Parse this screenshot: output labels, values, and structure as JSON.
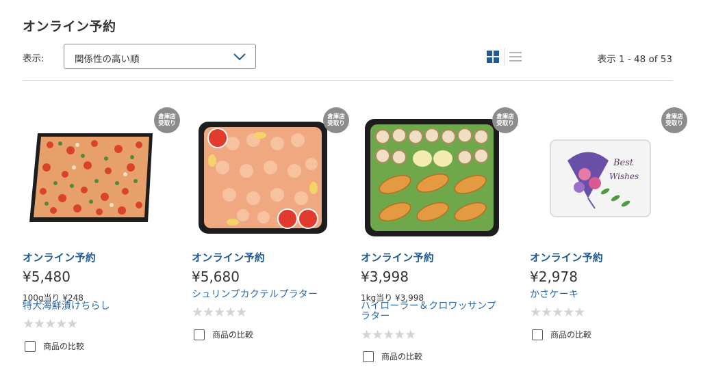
{
  "page": {
    "title": "オンライン予約"
  },
  "toolbar": {
    "sort_label": "表示:",
    "sort_value": "関係性の高い順",
    "result_count": "表示 1 - 48 of 53",
    "grid_icon": "grid-view-icon",
    "list_icon": "list-view-icon",
    "accent_color": "#1f5a96"
  },
  "products": [
    {
      "badge_line1": "倉庫店",
      "badge_line2": "受取り",
      "tag": "オンライン予約",
      "price": "¥5,480",
      "unit_price": "100g当り ¥248",
      "name": "特大海鮮漬けちらし",
      "rating_stars": "★★★★★",
      "compare_label": "商品の比較"
    },
    {
      "badge_line1": "倉庫店",
      "badge_line2": "受取り",
      "tag": "オンライン予約",
      "price": "¥5,680",
      "unit_price": "",
      "name": "シュリンプカクテルプラター",
      "rating_stars": "★★★★★",
      "compare_label": "商品の比較"
    },
    {
      "badge_line1": "倉庫店",
      "badge_line2": "受取り",
      "tag": "オンライン予約",
      "price": "¥3,998",
      "unit_price": "1kg当り ¥3,998",
      "name": "ハイローラー＆クロワッサンプラター",
      "rating_stars": "★★★★★",
      "compare_label": "商品の比較"
    },
    {
      "badge_line1": "倉庫店",
      "badge_line2": "受取り",
      "tag": "オンライン予約",
      "price": "¥2,978",
      "unit_price": "",
      "name": "かさケーキ",
      "rating_stars": "★★★★★",
      "compare_label": "商品の比較"
    }
  ]
}
